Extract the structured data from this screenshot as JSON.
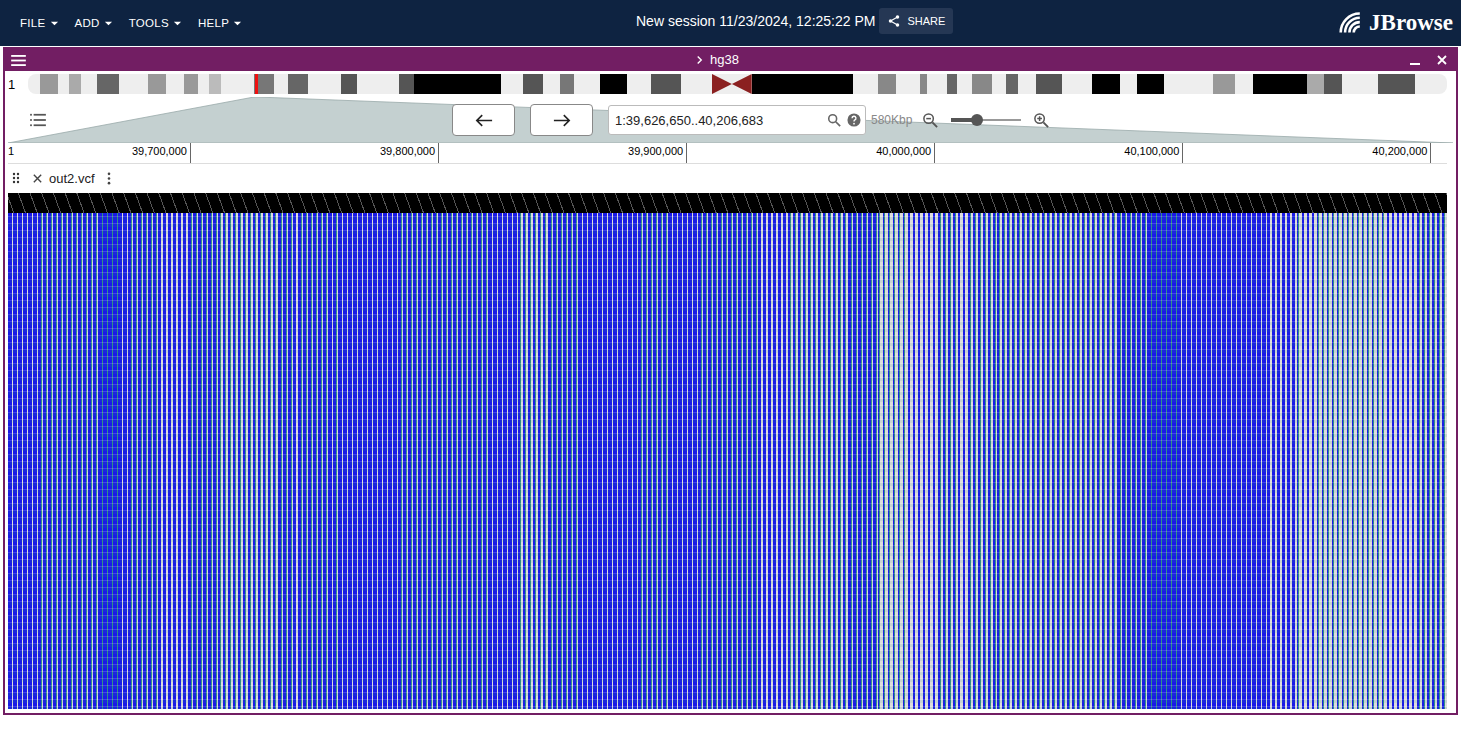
{
  "menubar": {
    "menus": [
      {
        "label": "FILE"
      },
      {
        "label": "ADD"
      },
      {
        "label": "TOOLS"
      },
      {
        "label": "HELP"
      }
    ],
    "title": "New session 11/23/2024, 12:25:22 PM",
    "share": "SHARE",
    "logo": "JBrowse"
  },
  "view": {
    "assembly": "hg38"
  },
  "ideogram": {
    "chromosome": "1",
    "marker": 0.16,
    "bands": [
      {
        "length": 12,
        "color": "#eeeeee",
        "kind": "band"
      },
      {
        "length": 18,
        "color": "#999999",
        "kind": "band"
      },
      {
        "length": 12,
        "color": "#eeeeee",
        "kind": "band"
      },
      {
        "length": 12,
        "color": "#aaaaaa",
        "kind": "band"
      },
      {
        "length": 16,
        "color": "#eeeeee",
        "kind": "band"
      },
      {
        "length": 22,
        "color": "#666666",
        "kind": "band"
      },
      {
        "length": 30,
        "color": "#eeeeee",
        "kind": "band"
      },
      {
        "length": 18,
        "color": "#999999",
        "kind": "band"
      },
      {
        "length": 18,
        "color": "#eeeeee",
        "kind": "band"
      },
      {
        "length": 14,
        "color": "#999999",
        "kind": "band"
      },
      {
        "length": 12,
        "color": "#eeeeee",
        "kind": "band"
      },
      {
        "length": 12,
        "color": "#bbbbbb",
        "kind": "band"
      },
      {
        "length": 33,
        "color": "#eeeeee",
        "kind": "band"
      },
      {
        "length": 21,
        "color": "#777777",
        "kind": "band"
      },
      {
        "length": 14,
        "color": "#eeeeee",
        "kind": "band"
      },
      {
        "length": 20,
        "color": "#666666",
        "kind": "band"
      },
      {
        "length": 33,
        "color": "#eeeeee",
        "kind": "band"
      },
      {
        "length": 17,
        "color": "#555555",
        "kind": "band"
      },
      {
        "length": 42,
        "color": "#eeeeee",
        "kind": "band"
      },
      {
        "length": 16,
        "color": "#555555",
        "kind": "band"
      },
      {
        "length": 88,
        "color": "#000000",
        "kind": "band"
      },
      {
        "length": 22,
        "color": "#eeeeee",
        "kind": "band"
      },
      {
        "length": 20,
        "color": "#555555",
        "kind": "band"
      },
      {
        "length": 18,
        "color": "#eeeeee",
        "kind": "band"
      },
      {
        "length": 14,
        "color": "#777777",
        "kind": "band"
      },
      {
        "length": 26,
        "color": "#eeeeee",
        "kind": "band"
      },
      {
        "length": 28,
        "color": "#000000",
        "kind": "band"
      },
      {
        "length": 24,
        "color": "#eeeeee",
        "kind": "band"
      },
      {
        "length": 30,
        "color": "#555555",
        "kind": "band"
      },
      {
        "length": 32,
        "color": "#eeeeee",
        "kind": "band"
      },
      {
        "length": 20,
        "color": "#8b2020",
        "kind": "acen"
      },
      {
        "length": 103,
        "color": "#000000",
        "kind": "band"
      },
      {
        "length": 25,
        "color": "#eeeeee",
        "kind": "band"
      },
      {
        "length": 18,
        "color": "#888888",
        "kind": "band"
      },
      {
        "length": 24,
        "color": "#eeeeee",
        "kind": "band"
      },
      {
        "length": 8,
        "color": "#888888",
        "kind": "band"
      },
      {
        "length": 20,
        "color": "#eeeeee",
        "kind": "band"
      },
      {
        "length": 10,
        "color": "#666666",
        "kind": "band"
      },
      {
        "length": 15,
        "color": "#eeeeee",
        "kind": "band"
      },
      {
        "length": 20,
        "color": "#888888",
        "kind": "band"
      },
      {
        "length": 15,
        "color": "#eeeeee",
        "kind": "band"
      },
      {
        "length": 12,
        "color": "#666666",
        "kind": "band"
      },
      {
        "length": 18,
        "color": "#eeeeee",
        "kind": "band"
      },
      {
        "length": 27,
        "color": "#555555",
        "kind": "band"
      },
      {
        "length": 30,
        "color": "#eeeeee",
        "kind": "band"
      },
      {
        "length": 28,
        "color": "#000000",
        "kind": "band"
      },
      {
        "length": 18,
        "color": "#eeeeee",
        "kind": "band"
      },
      {
        "length": 27,
        "color": "#000000",
        "kind": "band"
      },
      {
        "length": 50,
        "color": "#eeeeee",
        "kind": "band"
      },
      {
        "length": 22,
        "color": "#999999",
        "kind": "band"
      },
      {
        "length": 18,
        "color": "#eeeeee",
        "kind": "band"
      },
      {
        "length": 55,
        "color": "#000000",
        "kind": "band"
      },
      {
        "length": 17,
        "color": "#aaaaaa",
        "kind": "band"
      },
      {
        "length": 18,
        "color": "#555555",
        "kind": "band"
      },
      {
        "length": 37,
        "color": "#eeeeee",
        "kind": "band"
      },
      {
        "length": 38,
        "color": "#555555",
        "kind": "band"
      },
      {
        "length": 32,
        "color": "#eeeeee",
        "kind": "band"
      }
    ]
  },
  "navigation": {
    "location": "1:39,626,650..40,206,683",
    "width_label": "580Kbp",
    "zoom_level": 0.37
  },
  "ruler": {
    "chromosome": "1",
    "start": 39626650,
    "end": 40206683,
    "ticks": [
      {
        "value": 39700000,
        "label": "39,700,000"
      },
      {
        "value": 39800000,
        "label": "39,800,000"
      },
      {
        "value": 39900000,
        "label": "39,900,000"
      },
      {
        "value": 40000000,
        "label": "40,000,000"
      },
      {
        "value": 40100000,
        "label": "40,100,000"
      },
      {
        "value": 40200000,
        "label": "40,200,000"
      }
    ]
  },
  "track": {
    "name": "out2.vcf",
    "columns": [
      {
        "level": 0.75,
        "teal": 0.1
      },
      {
        "level": 0.7,
        "teal": 0.15
      },
      {
        "level": 0.65,
        "teal": 0.15
      },
      {
        "level": 0.8,
        "teal": 0.1
      },
      {
        "level": 0.6,
        "teal": 0.15
      },
      {
        "level": 0.55,
        "teal": 0.15
      },
      {
        "level": 0.6,
        "teal": 0.15
      },
      {
        "level": 0.45,
        "teal": 0.15
      },
      {
        "level": 0.45,
        "teal": 0.15
      },
      {
        "level": 0.55,
        "teal": 0.15
      },
      {
        "level": 0.7,
        "teal": 0.1
      },
      {
        "level": 0.75,
        "teal": 0.1
      },
      {
        "level": 0.8,
        "teal": 0.08
      },
      {
        "level": 0.65,
        "teal": 0.12
      },
      {
        "level": 0.6,
        "teal": 0.15
      },
      {
        "level": 0.7,
        "teal": 0.1
      },
      {
        "level": 0.75,
        "teal": 0.1
      },
      {
        "level": 0.5,
        "teal": 0.15
      },
      {
        "level": 0.65,
        "teal": 0.12
      },
      {
        "level": 0.75,
        "teal": 0.1
      },
      {
        "level": 0.8,
        "teal": 0.08
      },
      {
        "level": 0.7,
        "teal": 0.1
      },
      {
        "level": 0.75,
        "teal": 0.1
      },
      {
        "level": 0.65,
        "teal": 0.12
      },
      {
        "level": 0.6,
        "teal": 0.15
      },
      {
        "level": 0.55,
        "teal": 0.15
      },
      {
        "level": 0.45,
        "teal": 0.15
      },
      {
        "level": 0.5,
        "teal": 0.15
      },
      {
        "level": 0.6,
        "teal": 0.1
      },
      {
        "level": 0.25,
        "teal": 0.1
      },
      {
        "level": 0.35,
        "teal": 0.1
      },
      {
        "level": 0.3,
        "teal": 0.2
      },
      {
        "level": 0.35,
        "teal": 0.2
      },
      {
        "level": 0.4,
        "teal": 0.2
      },
      {
        "level": 0.4,
        "teal": 0.2
      },
      {
        "level": 0.45,
        "teal": 0.2
      },
      {
        "level": 0.5,
        "teal": 0.2
      },
      {
        "level": 0.6,
        "teal": 0.15
      },
      {
        "level": 0.85,
        "teal": 0.05
      },
      {
        "level": 0.8,
        "teal": 0.08
      },
      {
        "level": 0.75,
        "teal": 0.1
      },
      {
        "level": 0.8,
        "teal": 0.08
      },
      {
        "level": 0.55,
        "teal": 0.15
      },
      {
        "level": 0.3,
        "teal": 0.15
      },
      {
        "level": 0.25,
        "teal": 0.15
      },
      {
        "level": 0.3,
        "teal": 0.2
      },
      {
        "level": 0.35,
        "teal": 0.15
      },
      {
        "level": 0.4,
        "teal": 0.15
      }
    ]
  }
}
